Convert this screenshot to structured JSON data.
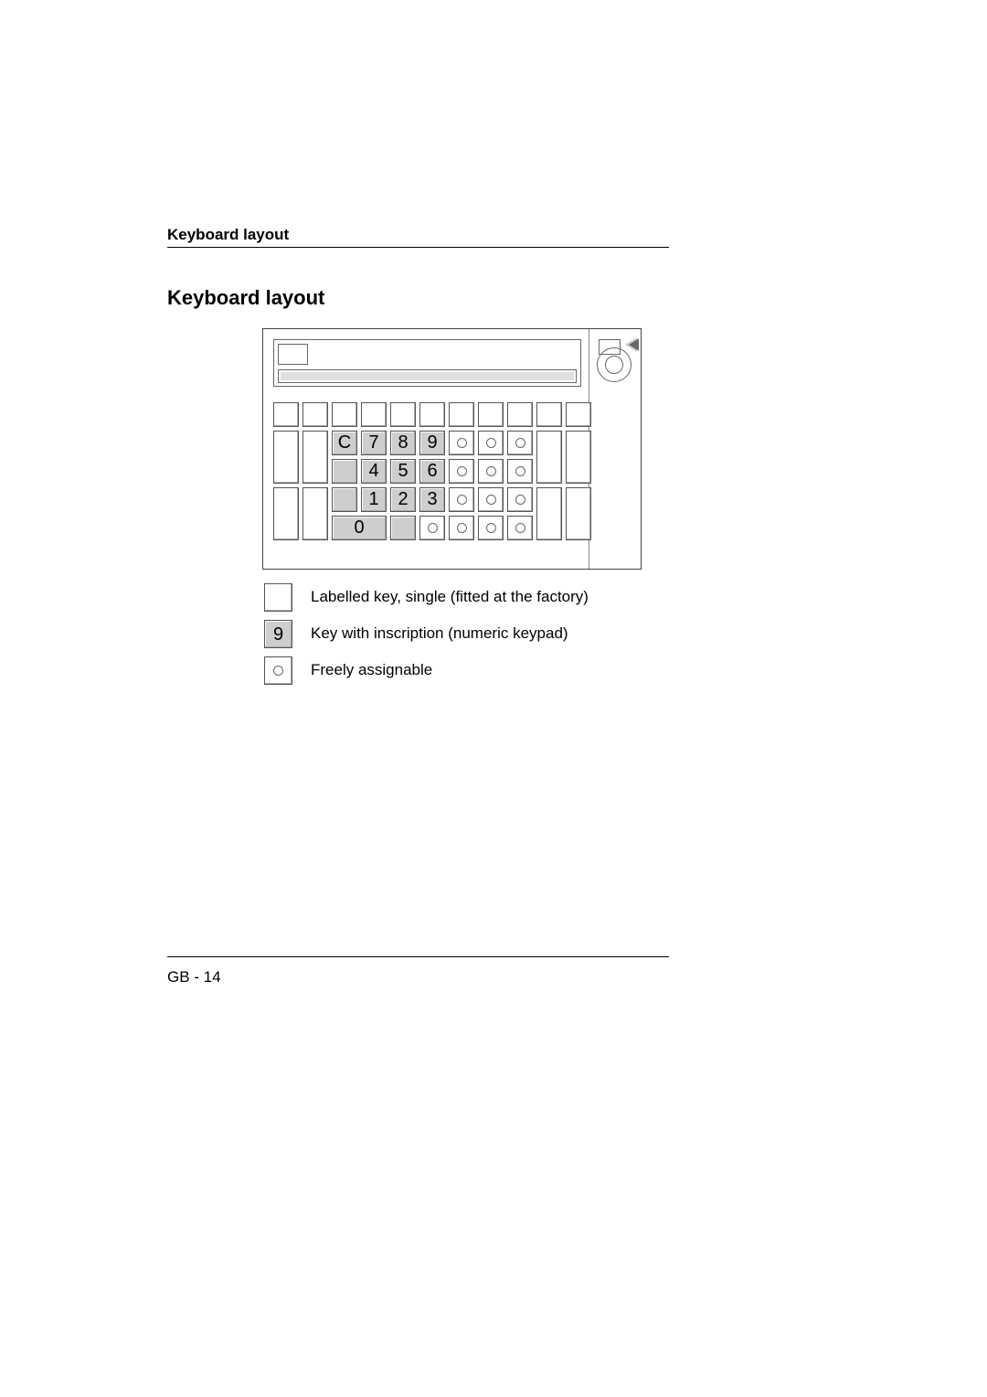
{
  "header": {
    "running_head": "Keyboard  layout"
  },
  "section": {
    "title": "Keyboard  layout"
  },
  "keypad": {
    "rows": [
      [
        "C",
        "7",
        "8",
        "9"
      ],
      [
        "",
        "4",
        "5",
        "6"
      ],
      [
        "",
        "1",
        "2",
        "3"
      ],
      [
        "0"
      ]
    ]
  },
  "legend": {
    "labelled": "Labelled key, single (fitted at the factory)",
    "numeric_sample": "9",
    "numeric": "Key with inscription (numeric keypad)",
    "free": "Freely assignable"
  },
  "footer": {
    "page_number": "GB - 14"
  }
}
